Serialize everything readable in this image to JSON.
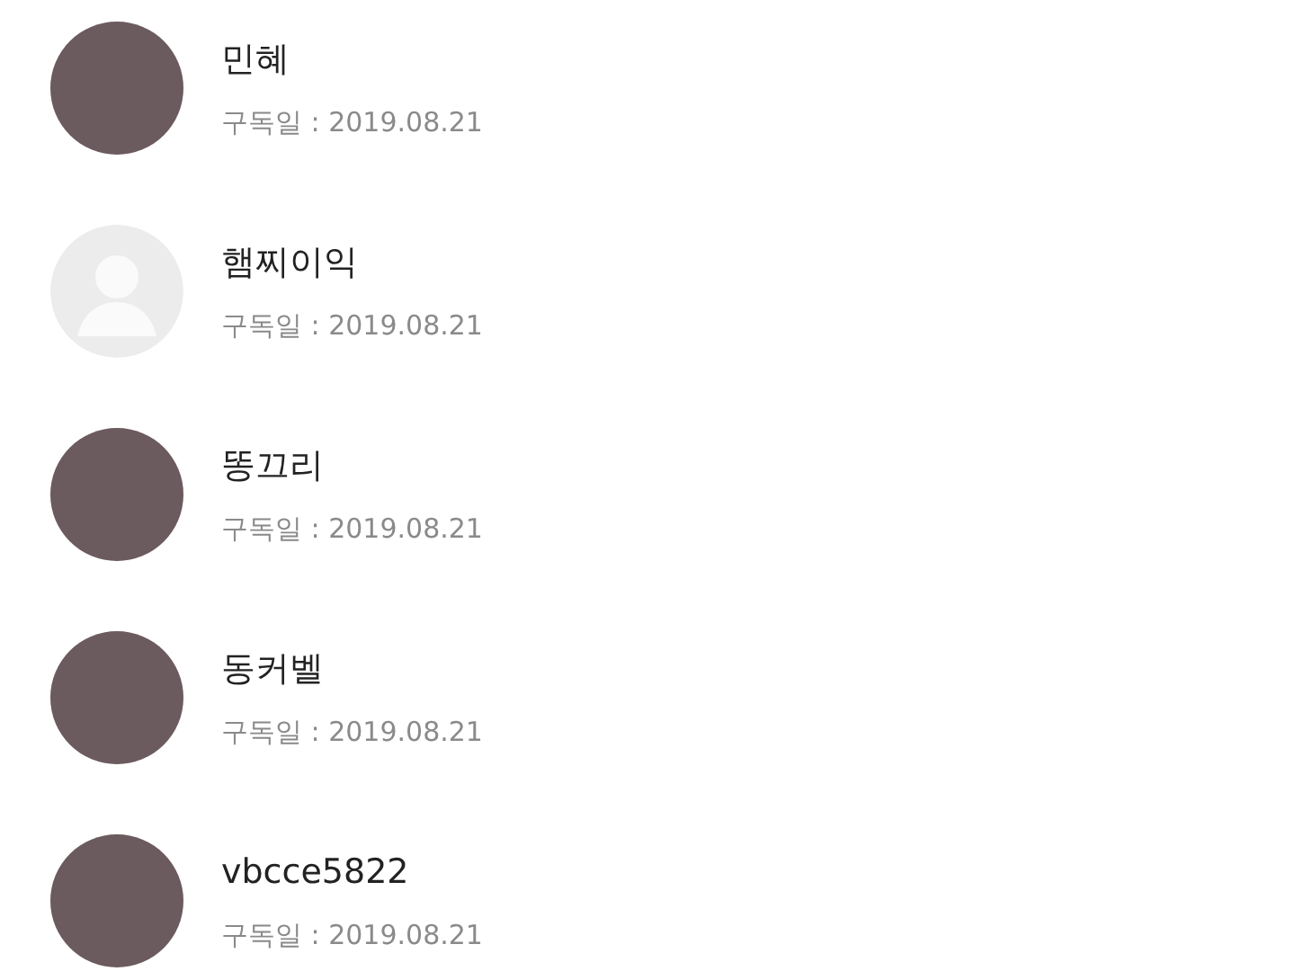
{
  "subscribers": [
    {
      "name": "민혜",
      "date": "구독일 : 2019.08.21",
      "kind": "photo"
    },
    {
      "name": "햄찌이익",
      "date": "구독일 : 2019.08.21",
      "kind": "default"
    },
    {
      "name": "똥끄리",
      "date": "구독일 : 2019.08.21",
      "kind": "photo"
    },
    {
      "name": "동커벨",
      "date": "구독일 : 2019.08.21",
      "kind": "photo"
    },
    {
      "name": "vbcce5822",
      "date": "구독일 : 2019.08.21",
      "kind": "photo"
    }
  ]
}
